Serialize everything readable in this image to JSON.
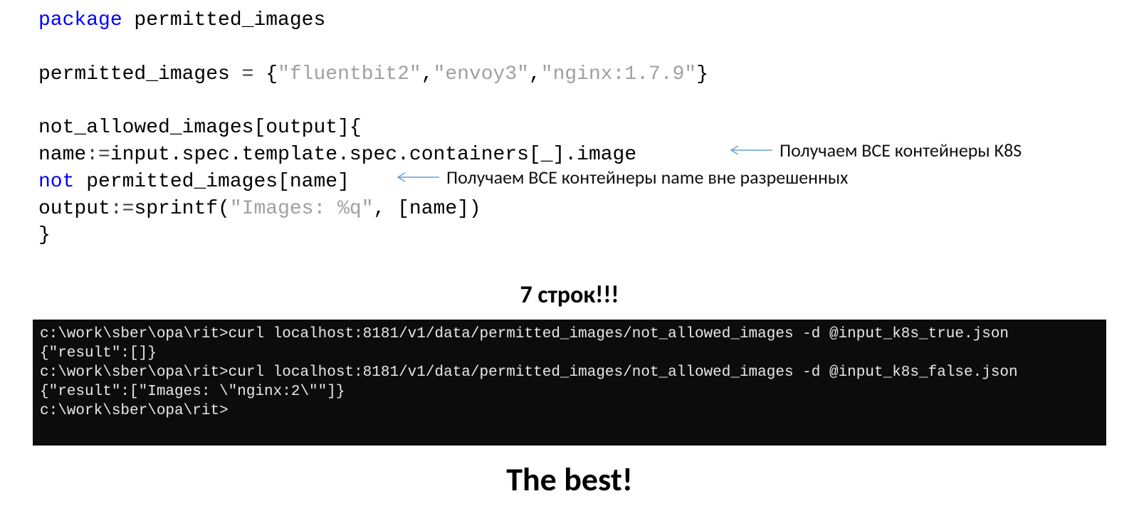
{
  "code": {
    "line1_kw": "package",
    "line1_rest": " permitted_images",
    "line3_a": "permitted_images ",
    "line3_eq": "=",
    "line3_brace_open": " {",
    "line3_str1": "\"fluentbit2\"",
    "line3_comma1": ",",
    "line3_str2": "\"envoy3\"",
    "line3_comma2": ",",
    "line3_str3": "\"nginx:1.7.9\"",
    "line3_brace_close": "}",
    "line5_a": "not_allowed_images[output]",
    "line5_brace": "{",
    "line6_a": "name",
    "line6_assign": ":=",
    "line6_b": "input.spec.template.spec.containers[",
    "line6_under": "_",
    "line6_c": "].image",
    "line7_not": "not",
    "line7_rest": " permitted_images[name]",
    "line8_a": "output",
    "line8_assign": ":=",
    "line8_b": "sprintf(",
    "line8_str": "\"Images: %q\"",
    "line8_c": ", [name])",
    "line9_brace": "}"
  },
  "annotations": {
    "a1": "Получаем ВСЕ контейнеры K8S",
    "a2": "Получаем ВСЕ контейнеры name вне разрешенных"
  },
  "mid_heading": "7 строк!!!",
  "terminal": {
    "l1": "c:\\work\\sber\\opa\\rit>curl localhost:8181/v1/data/permitted_images/not_allowed_images -d @input_k8s_true.json",
    "l2": "{\"result\":[]}",
    "l3": "c:\\work\\sber\\opa\\rit>curl localhost:8181/v1/data/permitted_images/not_allowed_images -d @input_k8s_false.json",
    "l4": "{\"result\":[\"Images: \\\"nginx:2\\\"\"]}",
    "l5": "c:\\work\\sber\\opa\\rit>"
  },
  "bottom_heading": "The best!"
}
